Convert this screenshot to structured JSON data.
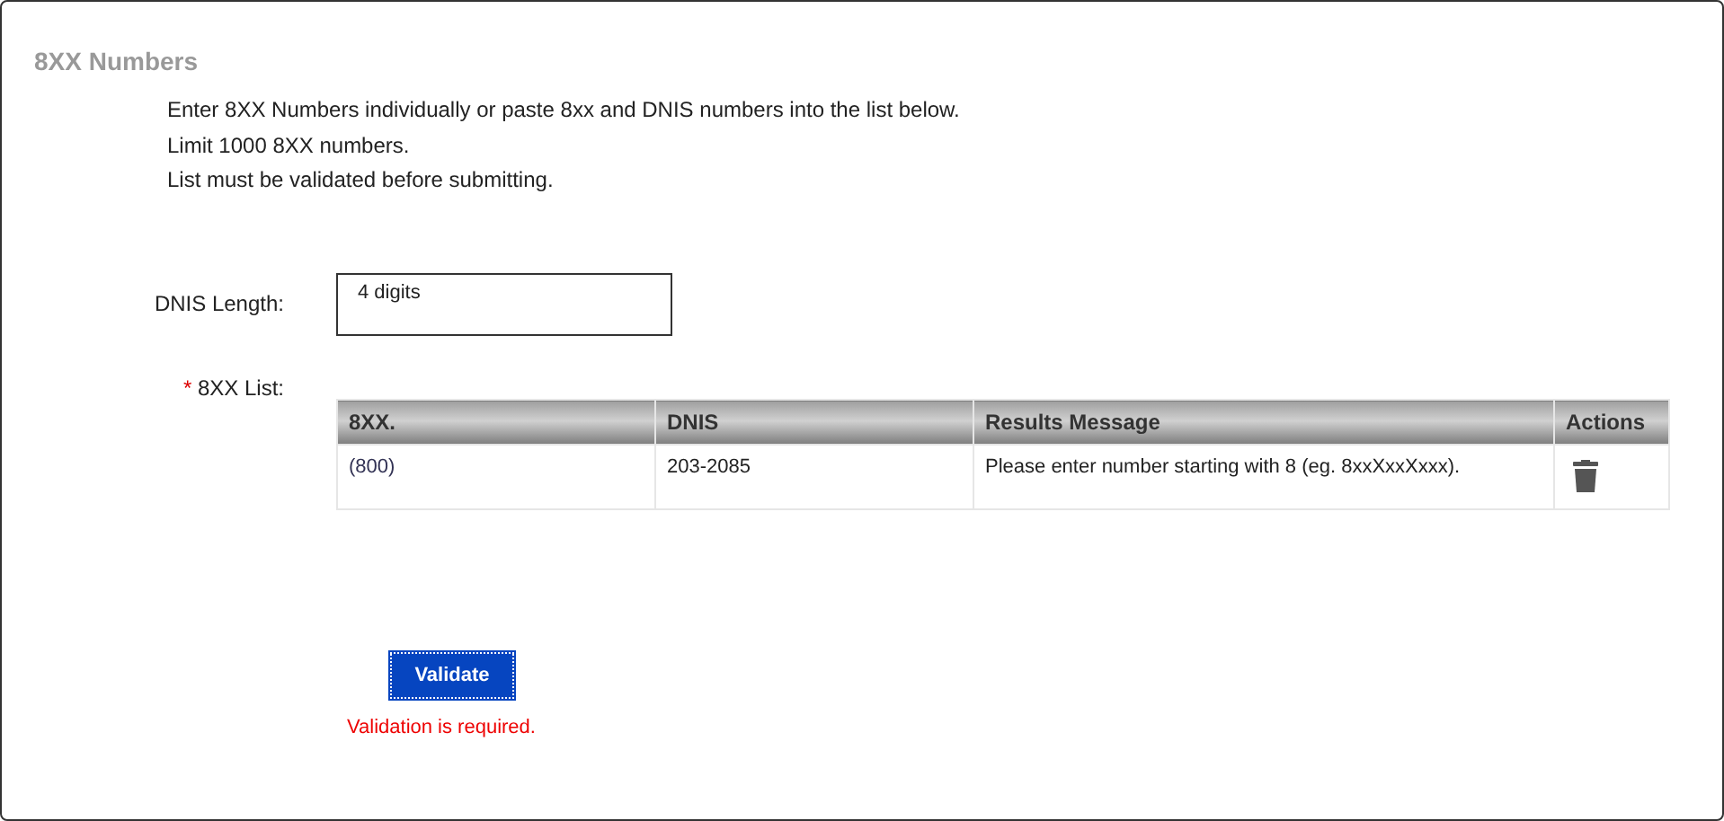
{
  "title": "8XX Numbers",
  "instructions": [
    "Enter 8XX Numbers individually or paste 8xx and DNIS numbers into the list below.",
    "Limit 1000 8XX numbers.",
    "List must be validated before submitting."
  ],
  "dnis_length": {
    "label": "DNIS Length:",
    "value": "4 digits"
  },
  "list": {
    "required_mark": "*",
    "label": "8XX List:"
  },
  "table": {
    "columns": [
      "8XX.",
      "DNIS",
      "Results Message",
      "Actions"
    ],
    "rows": [
      {
        "cells": [
          "(800)",
          "203-2085",
          "Please enter number starting with 8 (eg. 8xxXxxXxxx)."
        ]
      }
    ]
  },
  "validate_button": "Validate",
  "error": "Validation is required."
}
